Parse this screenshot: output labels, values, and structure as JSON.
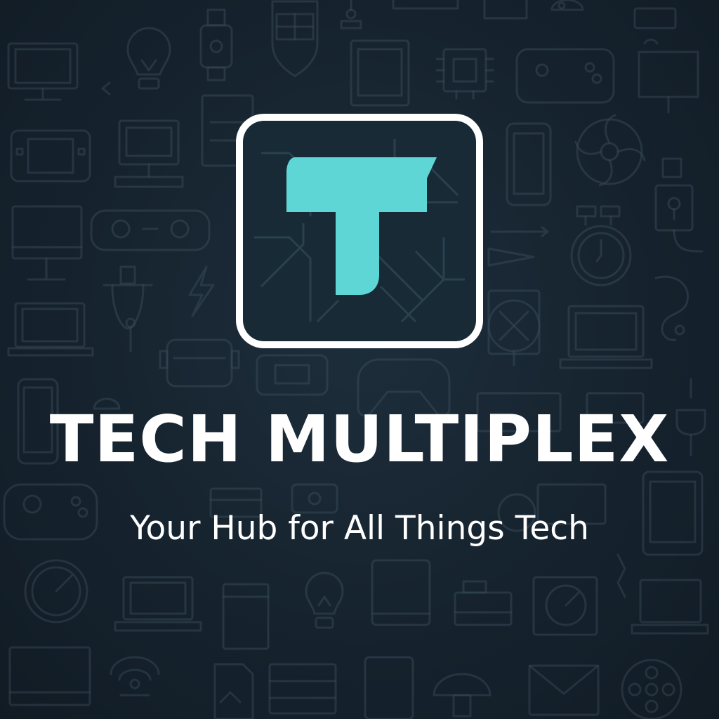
{
  "brand": {
    "name": "TECH MULTIPLEX",
    "tagline": "Your Hub for All Things Tech",
    "logo_letter": "T"
  },
  "colors": {
    "background": "#172531",
    "accent": "#5ed6d6",
    "text": "#ffffff",
    "icon_line": "#4f6473"
  },
  "icons": [
    "monitor-icon",
    "lightbulb-icon",
    "smartwatch-icon",
    "shield-icon",
    "joystick-icon",
    "cpu-chip-icon",
    "gamepad-icon",
    "handheld-console-icon",
    "desktop-computer-icon",
    "smartphone-icon",
    "fan-icon",
    "plug-icon",
    "lightning-icon",
    "router-icon",
    "laptop-icon",
    "clock-icon",
    "printer-icon",
    "tablet-icon",
    "envelope-icon",
    "speaker-icon",
    "film-reel-icon",
    "satellite-icon",
    "gauge-icon"
  ]
}
